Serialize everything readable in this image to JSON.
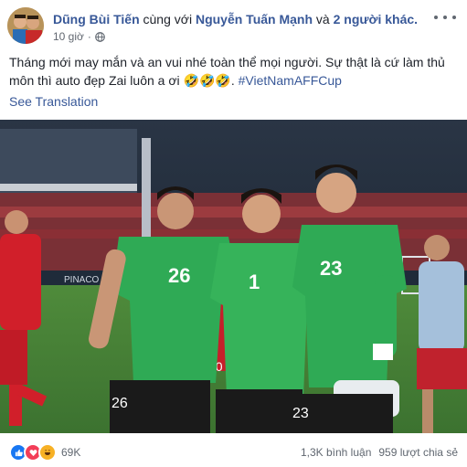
{
  "post": {
    "author": "Dũng Bùi Tiến",
    "with_text": "cùng với",
    "tagged": "Nguyễn Tuấn Mạnh",
    "and_text": "và",
    "others": "2 người khác.",
    "time": "10 giờ",
    "visibility_separator": "·",
    "text_line1": "Tháng mới may mắn và an vui nhé toàn thể mọi người. Sự thật là cứ làm thủ",
    "text_line2": "môn thì auto đẹp Zai luôn a ơi",
    "emojis": "🤣🤣🤣.",
    "hashtag": "#VietNamAFFCup",
    "see_translation": "See Translation"
  },
  "photo": {
    "jersey_numbers": [
      "26",
      "1",
      "23",
      "26",
      "20",
      "23"
    ],
    "banner": "PINACO"
  },
  "footer": {
    "reaction_count": "69K",
    "comments": "1,3K bình luận",
    "shares": "959 lượt chia sẻ"
  },
  "icons": {
    "avatar": "profile-avatar",
    "globe": "globe-icon",
    "more": "more-options-icon",
    "like": "like-reaction-icon",
    "love": "love-reaction-icon",
    "haha": "haha-reaction-icon"
  },
  "colors": {
    "link": "#385898",
    "jersey_green": "#2faa55",
    "red_kit": "#d11f2a",
    "like_blue": "#1877f2",
    "love_red": "#f33e58",
    "haha_yellow": "#f7b125"
  }
}
